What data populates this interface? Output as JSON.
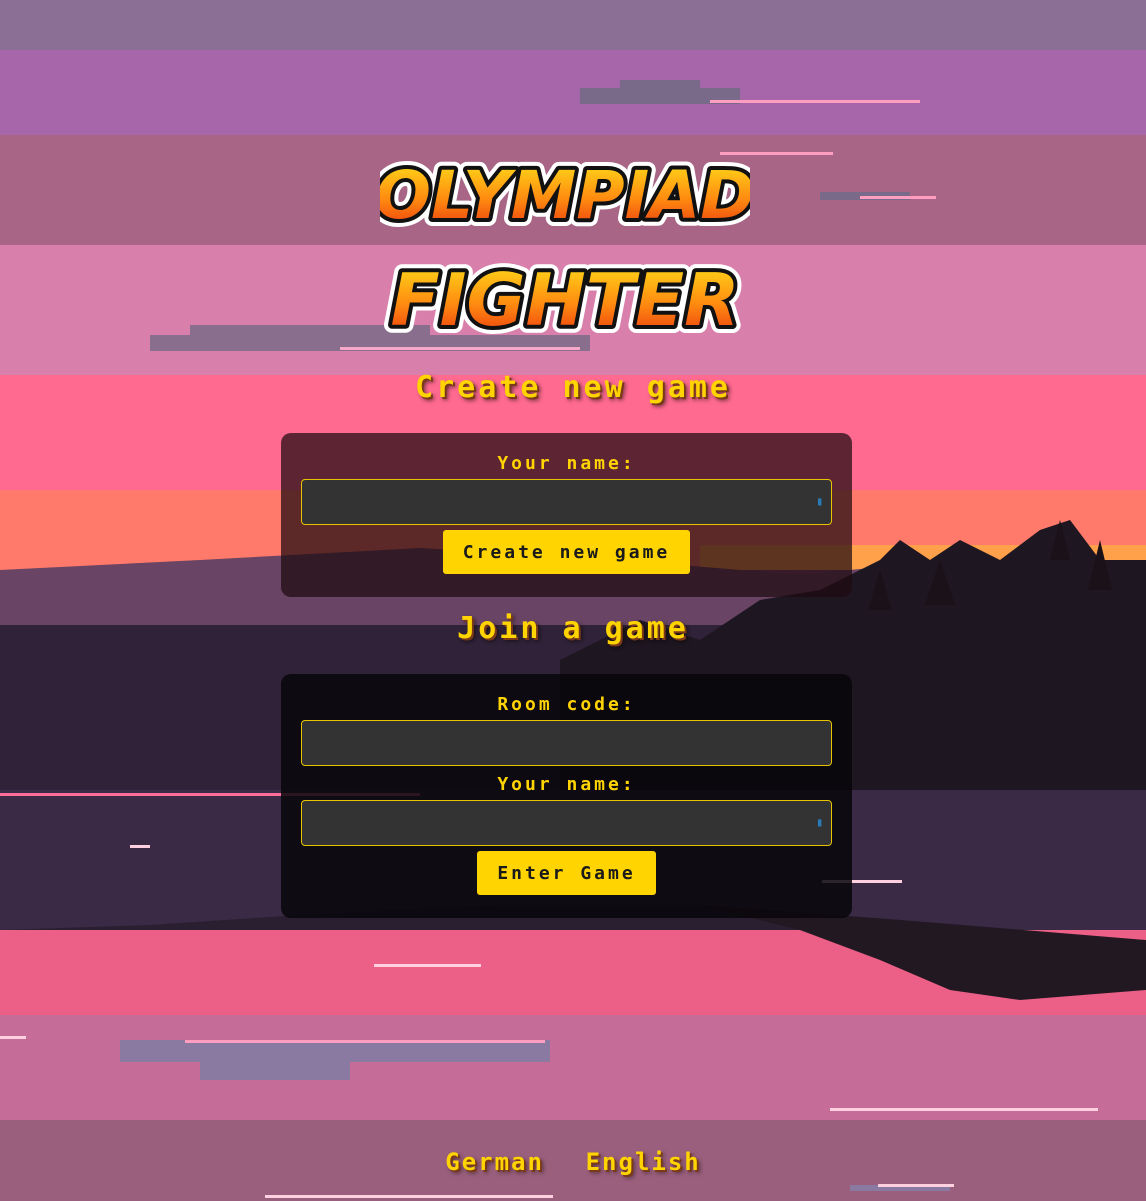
{
  "colors": {
    "accent": "#ffd400",
    "input_bg": "#333333",
    "input_border": "#e8c400",
    "button_text": "#1a1a1a"
  },
  "logo": {
    "line1": "OLYMPIAD",
    "line2": "FIGHTER"
  },
  "create_section": {
    "title": "Create new game",
    "name_label": "Your name:",
    "name_value": "",
    "button_label": "Create new game"
  },
  "join_section": {
    "title": "Join a game",
    "room_label": "Room code:",
    "room_value": "",
    "name_label": "Your name:",
    "name_value": "",
    "button_label": "Enter Game"
  },
  "languages": [
    "German",
    "English"
  ],
  "icons": {
    "autofill": "autofill-icon"
  }
}
